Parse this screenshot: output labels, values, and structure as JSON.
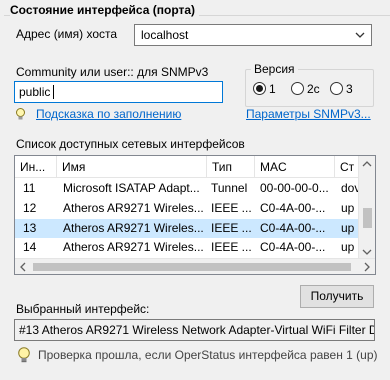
{
  "group": {
    "title": "Состояние интерфейса (порта)"
  },
  "host": {
    "label": "Адрес (имя) хоста",
    "value": "localhost"
  },
  "community": {
    "label": "Community или user:: для SNMPv3",
    "value": "public"
  },
  "links": {
    "hint": "Подсказка по заполнению",
    "snmpv3": "Параметры SNMPv3..."
  },
  "version": {
    "title": "Версия",
    "options": [
      {
        "label": "1",
        "selected": true
      },
      {
        "label": "2c",
        "selected": false
      },
      {
        "label": "3",
        "selected": false
      }
    ]
  },
  "interfaces": {
    "label": "Список доступных сетевых интерфейсов",
    "columns": [
      "Ин...",
      "Имя",
      "Тип",
      "MAC",
      "Ст"
    ],
    "rows": [
      {
        "idx": "11",
        "name": "Microsoft ISATAP Adapt...",
        "type": "Tunnel",
        "mac": "00-00-00-0...",
        "status": "dov",
        "selected": false
      },
      {
        "idx": "12",
        "name": "Atheros AR9271 Wireles...",
        "type": "IEEE ...",
        "mac": "C0-4A-00-...",
        "status": "up",
        "selected": false
      },
      {
        "idx": "13",
        "name": "Atheros AR9271 Wireles...",
        "type": "IEEE ...",
        "mac": "C0-4A-00-...",
        "status": "up",
        "selected": true
      },
      {
        "idx": "14",
        "name": "Atheros AR9271 Wireles...",
        "type": "IEEE ...",
        "mac": "C0-4A-00-...",
        "status": "up",
        "selected": false
      }
    ]
  },
  "get_button": {
    "label": "Получить"
  },
  "selected_interface": {
    "label": "Выбранный интерфейс:",
    "value": "#13 Atheros AR9271 Wireless Network Adapter-Virtual WiFi Filter Dr"
  },
  "hint": {
    "text": "Проверка прошла, если OperStatus интерфейса равен 1 (up)",
    "icon": "lightbulb-icon"
  },
  "colors": {
    "link": "#0066cc",
    "selection": "#cce8ff",
    "focus": "#0078d7"
  }
}
